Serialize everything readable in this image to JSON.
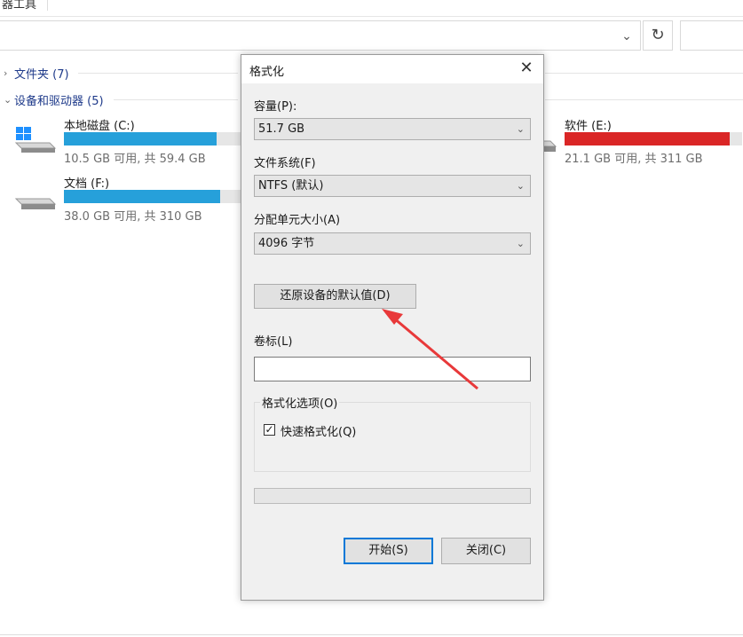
{
  "toolbar": {
    "label": "器工具"
  },
  "address_bar": {
    "dropdown_icon": "chevron-down-icon",
    "refresh_icon": "refresh-icon"
  },
  "groups": {
    "folders": "文件夹 (7)",
    "devices": "设备和驱动器 (5)"
  },
  "drives": [
    {
      "name": "本地磁盘 (C:)",
      "info": "10.5 GB 可用, 共 59.4 GB",
      "used_fraction": 0.86,
      "bar_color": "#26a0da",
      "icon": "windows-drive-icon"
    },
    {
      "name": "文档 (F:)",
      "info": "38.0 GB 可用, 共 310 GB",
      "used_fraction": 0.88,
      "bar_color": "#26a0da",
      "icon": "drive-icon"
    },
    {
      "name": "软件 (E:)",
      "info": "21.1 GB 可用, 共 311 GB",
      "used_fraction": 0.93,
      "bar_color": "#da2626",
      "icon": "drive-icon"
    }
  ],
  "dialog": {
    "title": "格式化",
    "capacity_label": "容量(P):",
    "capacity_value": "51.7 GB",
    "filesystem_label": "文件系统(F)",
    "filesystem_value": "NTFS (默认)",
    "alloc_label": "分配单元大小(A)",
    "alloc_value": "4096 字节",
    "restore_button": "还原设备的默认值(D)",
    "volume_label": "卷标(L)",
    "volume_value": "",
    "options_legend": "格式化选项(O)",
    "quick_format_label": "快速格式化(Q)",
    "quick_format_checked": true,
    "progress": 0,
    "start_button": "开始(S)",
    "close_button": "关闭(C)"
  },
  "colors": {
    "annotation_arrow": "#e8393a",
    "accent": "#0078d7"
  }
}
